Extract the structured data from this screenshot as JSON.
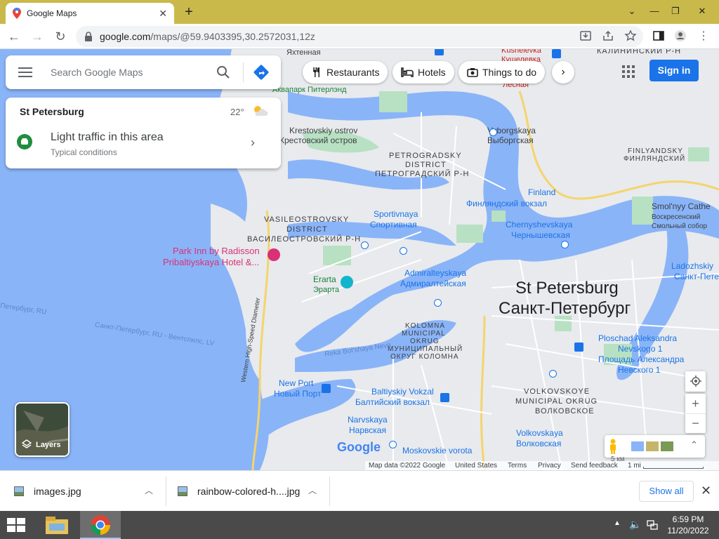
{
  "browser": {
    "tab_title": "Google Maps",
    "url_host": "google.com",
    "url_path": "/maps/@59.9403395,30.2572031,12z"
  },
  "maps": {
    "search_placeholder": "Search Google Maps",
    "chips": [
      "Restaurants",
      "Hotels",
      "Things to do"
    ],
    "sign_in": "Sign in",
    "card": {
      "city": "St Petersburg",
      "temperature": "22°",
      "traffic": "Light traffic in this area",
      "conditions": "Typical conditions"
    },
    "layers_label": "Layers",
    "google_logo": "Google",
    "footer": {
      "map_data": "Map data ©2022 Google",
      "country": "United States",
      "terms": "Terms",
      "privacy": "Privacy",
      "feedback": "Send feedback",
      "scale": "1 mi",
      "scale_km": "5 км"
    },
    "labels": {
      "yakhtennaya": "Яхтенная",
      "kushelevka_en": "Kushelevka",
      "kushelevka_ru": "Кушелевка",
      "kalininsky": "КАЛИНИНСКИЙ Р-Н",
      "akvapark": "Аквапарк Питерлэнд",
      "lesnaya": "Лесная",
      "krestovsky_en": "Krestovskiy ostrov",
      "krestovsky_ru": "Крестовский остров",
      "vyborgskaya_en": "Vyborgskaya",
      "vyborgskaya_ru": "Выборгская",
      "petrogradsky_1": "PETROGRADSKY",
      "petrogradsky_2": "DISTRICT",
      "petrogradsky_3": "ПЕТРОГРАДСКИЙ Р-Н",
      "finlyandsky_1": "FINLYANDSKY",
      "finlyandsky_2": "ФИНЛЯНДСКИЙ",
      "finland": "Finland",
      "finland_station": "Финляндский вокзал",
      "smolny_en": "Smol'nyy Cathe",
      "smolny_ru1": "Воскресенский",
      "smolny_ru2": "Смольный собор",
      "sportivnaya_en": "Sportivnaya",
      "sportivnaya_ru": "Спортивная",
      "vasileostrovsky_1": "VASILEOSTROVSKY",
      "vasileostrovsky_2": "DISTRICT",
      "vasileostrovsky_3": "ВАСИЛЕОСТРОВСКИЙ Р-Н",
      "chernyshevskaya_en": "Chernyshevskaya",
      "chernyshevskaya_ru": "Чернышевская",
      "park_inn_1": "Park Inn by Radisson",
      "park_inn_2": "Pribaltiyskaya Hotel &...",
      "ladozhskiy_en": "Ladozhskiy",
      "ladozhskiy_ru": "Санкт-Петер",
      "erarta_en": "Erarta",
      "erarta_ru": "Эрарта",
      "admiralteyskaya_en": "Admiralteyskaya",
      "admiralteyskaya_ru": "Адмиралтейская",
      "city_en": "St Petersburg",
      "city_ru": "Санкт-Петербург",
      "route_1": "Петербург, RU",
      "route_2": "Санкт-Петербург, RU - Вентспилс, LV",
      "kolomna_1": "KOLOMNA",
      "kolomna_2": "MUNICIPAL",
      "kolomna_3": "OKRUG",
      "kolomna_4": "МУНИЦИПАЛЬНЫЙ",
      "kolomna_5": "ОКРУГ КОЛОМНА",
      "reka": "Reka Bol'shaya Neva",
      "ploschad_1": "Ploschad Aleksandra",
      "ploschad_2": "Nevskogo 1",
      "ploschad_3": "Площадь Александра",
      "ploschad_4": "Невского 1",
      "diameter": "Western High-Speed Diameter",
      "newport_en": "New Port",
      "newport_ru": "Новый Порт",
      "baltiyskiy_en": "Baltiyskiy Vokzal",
      "baltiyskiy_ru": "Балтийский вокзал",
      "volkovskoye_1": "VOLKOVSKOYE",
      "volkovskoye_2": "MUNICIPAL OKRUG",
      "volkovskoye_3": "ВОЛКОВСКОЕ",
      "narvskaya_en": "Narvskaya",
      "narvskaya_ru": "Нарвская",
      "volkovskaya_en": "Volkovskaya",
      "volkovskaya_ru": "Волковская",
      "moskovskie": "Moskovskie vorota"
    }
  },
  "downloads": {
    "items": [
      "images.jpg",
      "rainbow-colored-h....jpg"
    ],
    "show_all": "Show all"
  },
  "taskbar": {
    "time": "6:59 PM",
    "date": "11/20/2022"
  },
  "colors": {
    "accent": "#1a73e8",
    "water": "#8ab4f8",
    "land": "#e8eaed",
    "park": "#b7e1c2",
    "tabbar": "#c9b94a",
    "taskbar": "#4a4a4a"
  }
}
